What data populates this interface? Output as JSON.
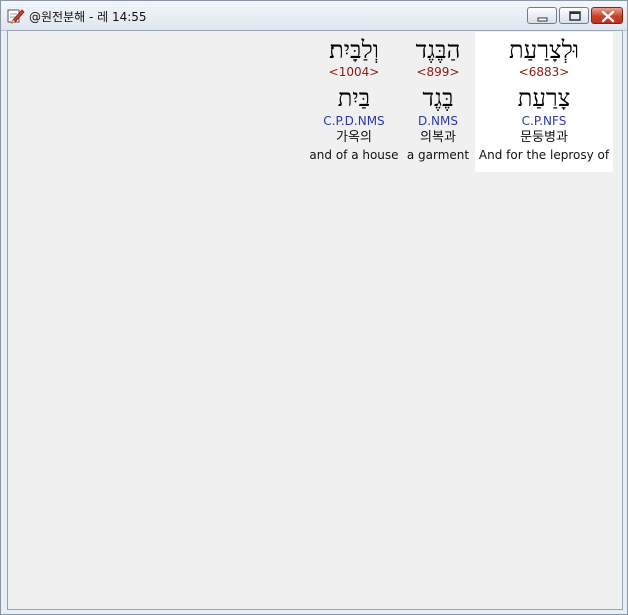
{
  "window": {
    "title": "@원전분해 - 레 14:55",
    "controls": {
      "minimize": "minimize",
      "maximize": "maximize",
      "close": "close"
    }
  },
  "words": [
    {
      "hebrew": "וּלְצָרַעַת",
      "strongs": "<6883>",
      "lexeme": "צָרַעַת",
      "morph": "C.P.NFS",
      "korean": "문둥병과",
      "english": "And for the leprosy of",
      "selected": true
    },
    {
      "hebrew": "הַבֶּגֶד",
      "strongs": "<899>",
      "lexeme": "בֶּגֶד",
      "morph": "D.NMS",
      "korean": "의복과",
      "english": "a garment",
      "selected": false
    },
    {
      "hebrew": "וְלַבָּיִת׃",
      "strongs": "<1004>",
      "lexeme": "בַּיִת",
      "morph": "C.P.D.NMS",
      "korean": "가옥의",
      "english": "and of a house",
      "selected": false
    }
  ],
  "colors": {
    "strongs": "#8b1a1a",
    "morph": "#2b3aa8",
    "highlight": "#ffffff",
    "background": "#f0f0f0"
  },
  "icons": {
    "app": "pencil-icon"
  }
}
